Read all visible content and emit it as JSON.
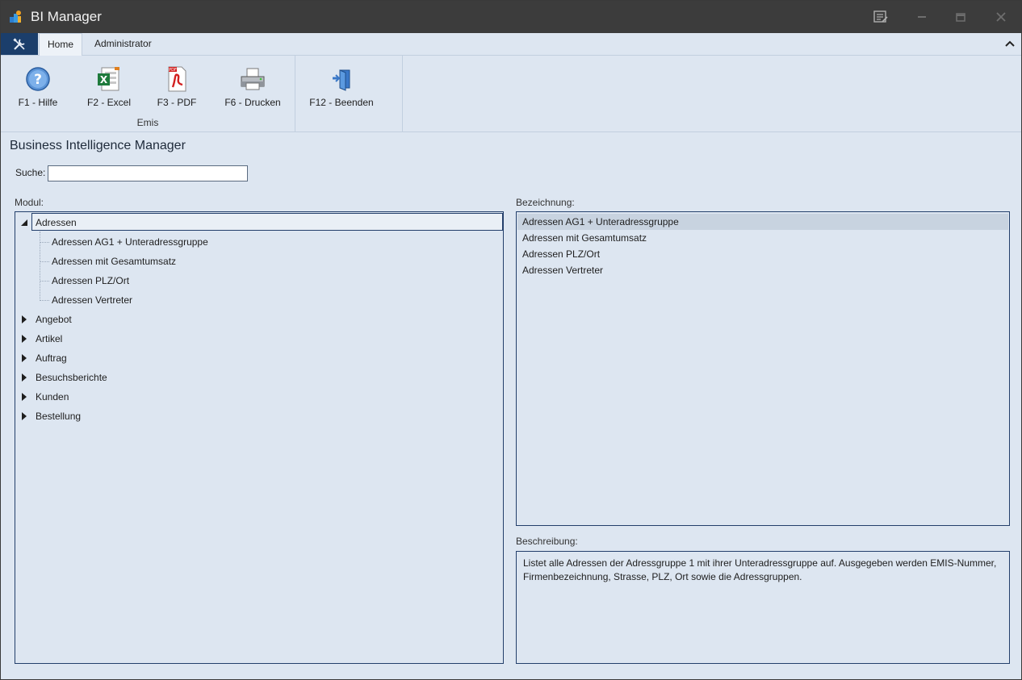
{
  "window": {
    "title": "BI Manager",
    "icons": {
      "app": "bi-manager-app-icon",
      "notes": "notes-icon",
      "minimize": "minimize-icon",
      "restore": "restore-icon",
      "close": "close-icon"
    }
  },
  "ribbon": {
    "file_icon": "tools-icon",
    "tabs": [
      "Home",
      "Administrator"
    ],
    "active_tab": "Home",
    "groups": [
      {
        "label": "Emis",
        "buttons": [
          {
            "label": "F1 - Hilfe",
            "icon": "help-icon"
          },
          {
            "label": "F2 - Excel",
            "icon": "excel-icon"
          },
          {
            "label": "F3 - PDF",
            "icon": "pdf-icon"
          },
          {
            "label": "F6 - Drucken",
            "icon": "printer-icon"
          }
        ]
      },
      {
        "label": "",
        "buttons": [
          {
            "label": "F12 - Beenden",
            "icon": "exit-door-icon"
          }
        ]
      }
    ]
  },
  "main": {
    "heading": "Business Intelligence Manager",
    "search": {
      "label": "Suche:",
      "value": "",
      "placeholder": ""
    },
    "modul_label": "Modul:",
    "bezeichnung_label": "Bezeichnung:",
    "beschreibung_label": "Beschreibung:",
    "tree": [
      {
        "label": "Adressen",
        "expanded": true,
        "selected": true,
        "children": [
          "Adressen AG1 + Unteradressgruppe",
          "Adressen mit Gesamtumsatz",
          "Adressen PLZ/Ort",
          "Adressen Vertreter"
        ]
      },
      {
        "label": "Angebot",
        "expanded": false
      },
      {
        "label": "Artikel",
        "expanded": false
      },
      {
        "label": "Auftrag",
        "expanded": false
      },
      {
        "label": "Besuchsberichte",
        "expanded": false
      },
      {
        "label": "Kunden",
        "expanded": false
      },
      {
        "label": "Bestellung",
        "expanded": false
      }
    ],
    "bezeichnung_items": [
      "Adressen AG1 + Unteradressgruppe",
      "Adressen mit Gesamtumsatz",
      "Adressen PLZ/Ort",
      "Adressen Vertreter"
    ],
    "bezeichnung_selected": "Adressen AG1 + Unteradressgruppe",
    "beschreibung": "Listet alle Adressen der Adressgruppe 1 mit ihrer Unteradressgruppe auf. Ausgegeben werden EMIS-Nummer, Firmenbezeichnung, Strasse, PLZ, Ort sowie die Adressgruppen."
  },
  "colors": {
    "titlebar": "#3c3c3c",
    "accent": "#1b3e6b",
    "background": "#dde6f1",
    "border": "#233f6b",
    "selection": "#c8d3e0"
  }
}
